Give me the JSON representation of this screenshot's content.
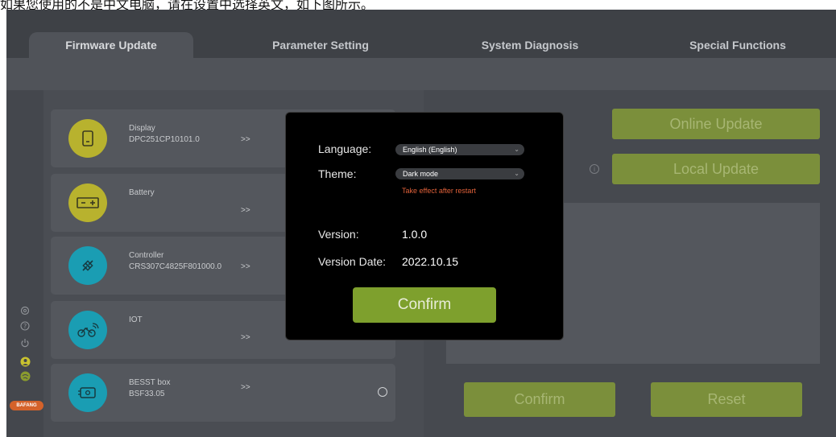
{
  "caption": "如果您使用的不是中文电脑，请在设置中选择英文，如下图所示。",
  "tabs": [
    {
      "label": "Firmware Update",
      "active": true
    },
    {
      "label": "Parameter Setting",
      "active": false
    },
    {
      "label": "System Diagnosis",
      "active": false
    },
    {
      "label": "Special Functions",
      "active": false
    }
  ],
  "devices": [
    {
      "title": "Display",
      "sub": "DPC251CP10101.0",
      "arrow": ">>",
      "icon": "display-icon",
      "color": "#b8b22e"
    },
    {
      "title": "Battery",
      "sub": "",
      "arrow": ">>",
      "icon": "battery-icon",
      "color": "#b8b22e"
    },
    {
      "title": "Controller",
      "sub": "CRS307C4825F801000.0",
      "arrow": ">>",
      "icon": "controller-icon",
      "color": "#1a9db3"
    },
    {
      "title": "IOT",
      "sub": "",
      "arrow": ">>",
      "icon": "iot-icon",
      "color": "#1a9db3"
    },
    {
      "title": "BESST box",
      "sub": "BSF33.05",
      "arrow": ">>",
      "icon": "besst-box-icon",
      "color": "#1a9db3"
    }
  ],
  "right": {
    "online_update": "Online Update",
    "local_update": "Local Update",
    "confirm": "Confirm",
    "reset": "Reset"
  },
  "sidebar": {
    "logo_text": "BAFANG"
  },
  "modal": {
    "language_label": "Language:",
    "language_value": "English (English)",
    "theme_label": "Theme:",
    "theme_value": "Dark mode",
    "theme_note": "Take effect after restart",
    "version_label": "Version:",
    "version_value": "1.0.0",
    "version_date_label": "Version Date:",
    "version_date_value": "2022.10.15",
    "confirm": "Confirm"
  },
  "colors": {
    "accent_green": "#7ea02d",
    "warning": "#e0613a",
    "teal": "#1a9db3",
    "olive": "#b8b22e"
  }
}
